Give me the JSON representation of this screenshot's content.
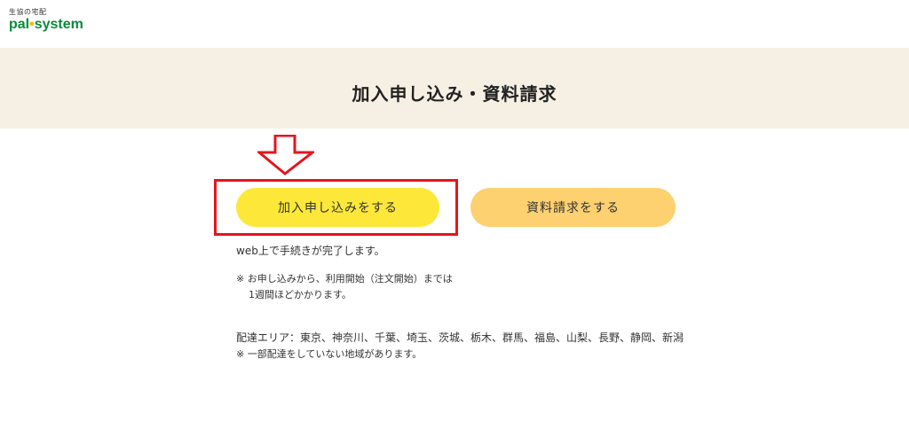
{
  "logo": {
    "subtitle": "生協の宅配",
    "brand_part1": "pal",
    "brand_dot": "•",
    "brand_part2": "system"
  },
  "page_title": "加入申し込み・資料請求",
  "buttons": {
    "join": "加入申し込みをする",
    "documents": "資料請求をする"
  },
  "notes": {
    "web_complete": "web上で手続きが完了します。",
    "start_line1": "※ お申し込みから、利用開始（注文開始）までは",
    "start_line2": "1週間ほどかかります。",
    "area": "配達エリア：東京、神奈川、千葉、埼玉、茨城、栃木、群馬、福島、山梨、長野、静岡、新潟",
    "area_note": "※ 一部配達をしていない地域があります。"
  },
  "colors": {
    "brand_green": "#0a8a3a",
    "title_band": "#f5f0e3",
    "join_button": "#fde83a",
    "documents_button": "#fdd070",
    "annotation_red": "#e5141e"
  }
}
